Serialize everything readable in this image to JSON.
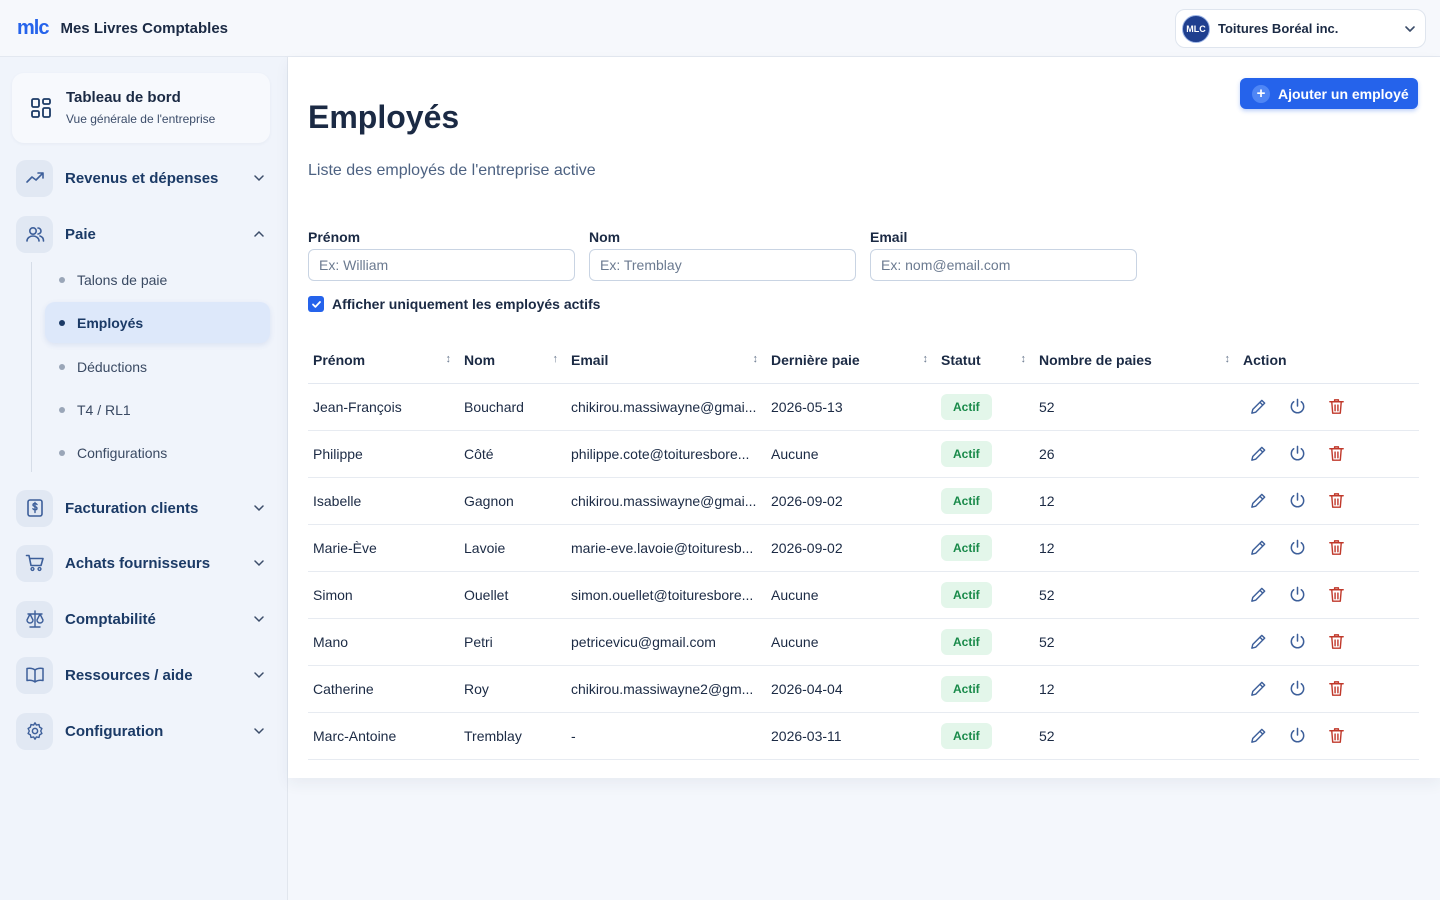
{
  "topbar": {
    "logo_text": "mlc",
    "app_name": "Mes Livres Comptables",
    "company_avatar": "MLC",
    "company_name": "Toitures Boréal inc."
  },
  "sidebar": {
    "dashboard": {
      "title": "Tableau de bord",
      "subtitle": "Vue générale de l'entreprise",
      "icon": "grid-icon"
    },
    "sections": [
      {
        "label": "Revenus et dépenses",
        "icon": "trend-icon",
        "expanded": false
      },
      {
        "label": "Paie",
        "icon": "users-icon",
        "expanded": true
      },
      {
        "label": "Facturation clients",
        "icon": "invoice-icon",
        "expanded": false
      },
      {
        "label": "Achats fournisseurs",
        "icon": "cart-icon",
        "expanded": false
      },
      {
        "label": "Comptabilité",
        "icon": "scale-icon",
        "expanded": false
      },
      {
        "label": "Ressources / aide",
        "icon": "book-icon",
        "expanded": false
      },
      {
        "label": "Configuration",
        "icon": "gear-icon",
        "expanded": false
      }
    ],
    "paie_items": [
      {
        "label": "Talons de paie",
        "active": false
      },
      {
        "label": "Employés",
        "active": true
      },
      {
        "label": "Déductions",
        "active": false
      },
      {
        "label": "T4 / RL1",
        "active": false
      },
      {
        "label": "Configurations",
        "active": false
      }
    ]
  },
  "main": {
    "title": "Employés",
    "subtitle": "Liste des employés de l'entreprise active",
    "add_button": "Ajouter un employé",
    "filters": {
      "first_name": {
        "label": "Prénom",
        "placeholder": "Ex: William",
        "value": ""
      },
      "last_name": {
        "label": "Nom",
        "placeholder": "Ex: Tremblay",
        "value": ""
      },
      "email": {
        "label": "Email",
        "placeholder": "Ex: nom@email.com",
        "value": ""
      }
    },
    "active_only": {
      "label": "Afficher uniquement les employés actifs",
      "checked": true
    },
    "table": {
      "columns": [
        "Prénom",
        "Nom",
        "Email",
        "Dernière paie",
        "Statut",
        "Nombre de paies",
        "Action"
      ],
      "rows": [
        [
          "Jean-François",
          "Bouchard",
          "chikirou.massiwayne@gmai...",
          "2026-05-13",
          "Actif",
          "52"
        ],
        [
          "Philippe",
          "Côté",
          "philippe.cote@toituresbore...",
          "Aucune",
          "Actif",
          "26"
        ],
        [
          "Isabelle",
          "Gagnon",
          "chikirou.massiwayne@gmai...",
          "2026-09-02",
          "Actif",
          "12"
        ],
        [
          "Marie-Ève",
          "Lavoie",
          "marie-eve.lavoie@toituresb...",
          "2026-09-02",
          "Actif",
          "12"
        ],
        [
          "Simon",
          "Ouellet",
          "simon.ouellet@toituresbore...",
          "Aucune",
          "Actif",
          "52"
        ],
        [
          "Mano",
          "Petri",
          "petricevicu@gmail.com",
          "Aucune",
          "Actif",
          "52"
        ],
        [
          "Catherine",
          "Roy",
          "chikirou.massiwayne2@gm...",
          "2026-04-04",
          "Actif",
          "12"
        ],
        [
          "Marc-Antoine",
          "Tremblay",
          "-",
          "2026-03-11",
          "Actif",
          "52"
        ]
      ]
    }
  },
  "colors": {
    "accent": "#2563eb",
    "active_badge_bg": "#e3f6ea",
    "active_badge_text": "#198a4a",
    "delete": "#c0392b"
  }
}
